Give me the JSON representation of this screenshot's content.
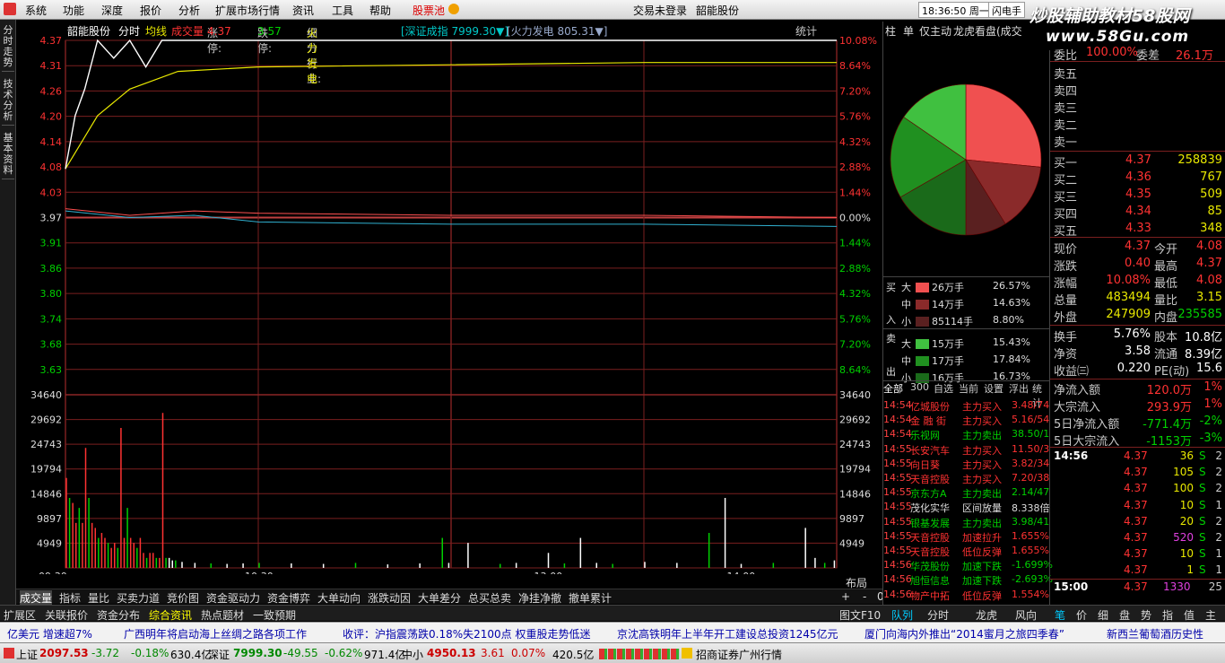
{
  "menu": {
    "items": [
      "系统",
      "功能",
      "深度",
      "报价",
      "分析",
      "扩展市场行情",
      "资讯",
      "工具",
      "帮助"
    ],
    "pool": "股票池",
    "center_left": "交易未登录",
    "center_right": "韶能股份",
    "time": "18:36:50",
    "weekday": "周一",
    "flash": "闪电手"
  },
  "watermark": {
    "line1": "炒股辅助教材58股网",
    "line2": "www.58Gu.com"
  },
  "left_tabs": [
    "分时走势",
    "技术分析",
    "基本资料"
  ],
  "chart_head": {
    "stock": "韶能股份",
    "mode": "分时",
    "avg": "均线",
    "vol": "成交量",
    "up_lbl": "涨停:",
    "up": "4.37",
    "down_lbl": "跌停:",
    "down": "3.57",
    "ind_lbl": "细分行业:",
    "ind": "火力发电",
    "idx": "[深证成指 7999.30▼]",
    "ind_idx": "[火力发电 805.31▼]",
    "stat": "统计"
  },
  "colors": {
    "up": "#ff3232",
    "down": "#00d000",
    "grid": "#7a1f1f",
    "price": "#ffffff",
    "avg": "#e8e800",
    "red_line": "#ff5050",
    "cyan_line": "#30b0d0"
  },
  "chart_data": {
    "type": "line",
    "price_axis": [
      "4.37",
      "4.31",
      "4.26",
      "4.20",
      "4.14",
      "4.08",
      "4.03",
      "3.97",
      "3.91",
      "3.86",
      "3.80",
      "3.74",
      "3.68",
      "3.63"
    ],
    "pct_axis": [
      "10.08%",
      "8.64%",
      "7.20%",
      "5.76%",
      "4.32%",
      "2.88%",
      "1.44%",
      "0.00%",
      "1.44%",
      "2.88%",
      "4.32%",
      "5.76%",
      "7.20%",
      "8.64%"
    ],
    "vol_axis": [
      "34640",
      "29692",
      "24743",
      "19794",
      "14846",
      "9897",
      "4949"
    ],
    "time_axis": [
      "09:30",
      "10:30",
      "13:00",
      "14:00"
    ],
    "ylim": [
      3.57,
      4.37
    ],
    "prev_close": 3.97,
    "price": [
      [
        0,
        4.08
      ],
      [
        3,
        4.2
      ],
      [
        6,
        4.26
      ],
      [
        10,
        4.37
      ],
      [
        15,
        4.33
      ],
      [
        20,
        4.37
      ],
      [
        25,
        4.31
      ],
      [
        30,
        4.37
      ],
      [
        40,
        4.37
      ],
      [
        60,
        4.37
      ],
      [
        240,
        4.37
      ]
    ],
    "avg": [
      [
        0,
        4.08
      ],
      [
        5,
        4.14
      ],
      [
        10,
        4.2
      ],
      [
        20,
        4.26
      ],
      [
        35,
        4.3
      ],
      [
        60,
        4.31
      ],
      [
        120,
        4.315
      ],
      [
        180,
        4.32
      ],
      [
        240,
        4.32
      ]
    ],
    "idx_red": [
      [
        0,
        3.99
      ],
      [
        20,
        3.975
      ],
      [
        40,
        3.985
      ],
      [
        60,
        3.98
      ],
      [
        120,
        3.975
      ],
      [
        180,
        3.975
      ],
      [
        240,
        3.97
      ]
    ],
    "idx_cyan": [
      [
        0,
        3.985
      ],
      [
        20,
        3.97
      ],
      [
        40,
        3.975
      ],
      [
        60,
        3.96
      ],
      [
        120,
        3.955
      ],
      [
        180,
        3.955
      ],
      [
        240,
        3.95
      ]
    ],
    "volume": [
      [
        0,
        18000
      ],
      [
        1,
        14000
      ],
      [
        2,
        13000
      ],
      [
        3,
        9000
      ],
      [
        4,
        12000
      ],
      [
        5,
        9000
      ],
      [
        6,
        24000
      ],
      [
        7,
        14000
      ],
      [
        8,
        9000
      ],
      [
        9,
        8000
      ],
      [
        10,
        6000
      ],
      [
        11,
        7000
      ],
      [
        12,
        6000
      ],
      [
        13,
        5000
      ],
      [
        14,
        4000
      ],
      [
        15,
        5000
      ],
      [
        16,
        4000
      ],
      [
        17,
        28000
      ],
      [
        18,
        6000
      ],
      [
        19,
        12000
      ],
      [
        20,
        6000
      ],
      [
        21,
        5000
      ],
      [
        22,
        4000
      ],
      [
        23,
        6000
      ],
      [
        24,
        3000
      ],
      [
        25,
        2000
      ],
      [
        26,
        3000
      ],
      [
        27,
        3000
      ],
      [
        28,
        2000
      ],
      [
        29,
        2000
      ],
      [
        30,
        31000
      ],
      [
        31,
        2000
      ],
      [
        32,
        2000
      ],
      [
        33,
        1500
      ],
      [
        34,
        1500
      ],
      [
        36,
        1200
      ],
      [
        40,
        1000
      ],
      [
        45,
        900
      ],
      [
        50,
        800
      ],
      [
        55,
        900
      ],
      [
        60,
        1000
      ],
      [
        70,
        900
      ],
      [
        80,
        800
      ],
      [
        90,
        1000
      ],
      [
        100,
        700
      ],
      [
        110,
        900
      ],
      [
        117,
        6000
      ],
      [
        119,
        1000
      ],
      [
        125,
        5000
      ],
      [
        135,
        800
      ],
      [
        140,
        1000
      ],
      [
        150,
        3000
      ],
      [
        155,
        900
      ],
      [
        160,
        6000
      ],
      [
        165,
        1000
      ],
      [
        170,
        800
      ],
      [
        180,
        1200
      ],
      [
        190,
        1000
      ],
      [
        200,
        7000
      ],
      [
        205,
        14000
      ],
      [
        210,
        800
      ],
      [
        220,
        1000
      ],
      [
        230,
        8000
      ],
      [
        233,
        2000
      ],
      [
        236,
        1000
      ],
      [
        239,
        1500
      ]
    ],
    "vol_max": 34640
  },
  "bottom_tabs": [
    "成交量",
    "指标",
    "量比",
    "买卖力道",
    "竞价图",
    "资金驱动力",
    "资金博弈",
    "大单动向",
    "涨跌动因",
    "大单差分",
    "总买总卖",
    "净挂净撤",
    "撤单累计"
  ],
  "bottom_right": [
    "布局",
    "+",
    "-",
    "0"
  ],
  "ext_tabs": [
    "扩展区",
    "关联报价",
    "资金分布",
    "综合资讯",
    "热点题材",
    "一致预期"
  ],
  "mid_tabs": [
    "柱",
    "单",
    "仅主动",
    "龙虎看盘(成交"
  ],
  "flow": {
    "buy_lbl": "买",
    "buy_in": "入",
    "sell_lbl": "卖",
    "sell_out": "出",
    "rows": [
      {
        "sz": "大",
        "amt": "26万手",
        "pct": "26.57%",
        "color": "#f05050"
      },
      {
        "sz": "中",
        "amt": "14万手",
        "pct": "14.63%",
        "color": "#8a2a2a"
      },
      {
        "sz": "小",
        "amt": "85114手",
        "pct": "8.80%",
        "color": "#5a2020"
      },
      {
        "sz": "大",
        "amt": "15万手",
        "pct": "15.43%",
        "color": "#40c040"
      },
      {
        "sz": "中",
        "amt": "17万手",
        "pct": "17.84%",
        "color": "#209020"
      },
      {
        "sz": "小",
        "amt": "16万手",
        "pct": "16.73%",
        "color": "#1a6a1a"
      }
    ]
  },
  "pie": [
    26.57,
    14.63,
    8.8,
    16.73,
    17.84,
    15.43
  ],
  "deal_tabs": [
    "全部",
    "300",
    "自选",
    "当前",
    "设置",
    "浮出",
    "统计"
  ],
  "deals": [
    [
      "14:54",
      "亿城股份",
      "主力买入",
      "3.48/74"
    ],
    [
      "14:54",
      "金 融 街",
      "主力买入",
      "5.16/54"
    ],
    [
      "14:54",
      "乐视网",
      "主力卖出",
      "38.50/1"
    ],
    [
      "14:55",
      "长安汽车",
      "主力买入",
      "11.50/3"
    ],
    [
      "14:55",
      "向日葵",
      "主力买入",
      "3.82/34"
    ],
    [
      "14:55",
      "天音控股",
      "主力买入",
      "7.20/38"
    ],
    [
      "14:55",
      "京东方A",
      "主力卖出",
      "2.14/47"
    ],
    [
      "14:55",
      "茂化实华",
      "区间放量",
      "8.338倍"
    ],
    [
      "14:55",
      "银基发展",
      "主力卖出",
      "3.98/41"
    ],
    [
      "14:55",
      "天音控股",
      "加速拉升",
      "1.655%"
    ],
    [
      "14:55",
      "天音控股",
      "低位反弹",
      "1.655%"
    ],
    [
      "14:56",
      "华茂股份",
      "加速下跌",
      "-1.699%"
    ],
    [
      "14:56",
      "旭恒信息",
      "加速下跌",
      "-2.693%"
    ],
    [
      "14:56",
      "物产中拓",
      "低位反弹",
      "1.554%"
    ],
    [
      "14:56",
      "启源装备",
      "低位反弹",
      "1.523%"
    ]
  ],
  "deal_colors": [
    "r",
    "r",
    "g",
    "r",
    "r",
    "r",
    "g",
    "w",
    "g",
    "r",
    "r",
    "g",
    "g",
    "r",
    "r"
  ],
  "mid_bottom": [
    "队列",
    "分时",
    "龙虎",
    "风向"
  ],
  "quote": {
    "top": [
      "委比",
      "100.00%",
      "委差",
      "26.1万"
    ],
    "sells": [
      "卖五",
      "卖四",
      "卖三",
      "卖二",
      "卖一"
    ],
    "buys": [
      [
        "买一",
        "4.37",
        "258839"
      ],
      [
        "买二",
        "4.36",
        "767"
      ],
      [
        "买三",
        "4.35",
        "509"
      ],
      [
        "买四",
        "4.34",
        "85"
      ],
      [
        "买五",
        "4.33",
        "348"
      ]
    ],
    "stats": [
      [
        "现价",
        "4.37",
        "今开",
        "4.08"
      ],
      [
        "涨跌",
        "0.40",
        "最高",
        "4.37"
      ],
      [
        "涨幅",
        "10.08%",
        "最低",
        "4.08"
      ],
      [
        "总量",
        "483494",
        "量比",
        "3.15"
      ],
      [
        "外盘",
        "247909",
        "内盘",
        "235585"
      ]
    ],
    "fin": [
      [
        "换手",
        "5.76%",
        "股本",
        "10.8亿"
      ],
      [
        "净资",
        "3.58",
        "流通",
        "8.39亿"
      ],
      [
        "收益㈢",
        "0.220",
        "PE(动)",
        "15.6"
      ]
    ],
    "flows": [
      [
        "净流入额",
        "120.0万",
        "1%"
      ],
      [
        "大宗流入",
        "293.9万",
        "1%"
      ],
      [
        "5日净流入额",
        "-771.4万",
        "-2%"
      ],
      [
        "5日大宗流入",
        "-1153万",
        "-3%"
      ]
    ],
    "ticks": [
      [
        "14:56",
        "4.37",
        "36",
        "S",
        "2"
      ],
      [
        "",
        "4.37",
        "105",
        "S",
        "2"
      ],
      [
        "",
        "4.37",
        "100",
        "S",
        "2"
      ],
      [
        "",
        "4.37",
        "10",
        "S",
        "1"
      ],
      [
        "",
        "4.37",
        "20",
        "S",
        "2"
      ],
      [
        "",
        "4.37",
        "520",
        "S",
        "2"
      ],
      [
        "",
        "4.37",
        "10",
        "S",
        "1"
      ],
      [
        "",
        "4.37",
        "1",
        "S",
        "1"
      ]
    ],
    "last_tick": [
      "15:00",
      "4.37",
      "1330",
      "25"
    ]
  },
  "right_tabs": [
    "笔",
    "价",
    "细",
    "盘",
    "势",
    "指",
    "值",
    "主"
  ],
  "tu": "图文F10",
  "news": [
    "亿美元  增速超7%",
    "广西明年将启动海上丝绸之路各项工作",
    "收评：沪指震荡跌0.18%失2100点  权重股走势低迷",
    "京沈高铁明年上半年开工建设总投资1245亿元",
    "厦门向海内外推出“2014蜜月之旅四季春”",
    "新西兰葡萄酒历史性"
  ],
  "status": {
    "sh_lbl": "上证",
    "sh": "2097.53",
    "sh_chg": "-3.72",
    "sh_pct": "-0.18%",
    "sh_amt": "630.4亿",
    "sz_lbl": "深证",
    "sz": "7999.30",
    "sz_chg": "-49.55",
    "sz_pct": "-0.62%",
    "sz_amt": "971.4亿",
    "zx_lbl": "中小",
    "zx": "4950.13",
    "zx_chg": "3.61",
    "zx_pct": "0.07%",
    "zx_amt": "420.5亿",
    "broker": "招商证券广州行情"
  }
}
